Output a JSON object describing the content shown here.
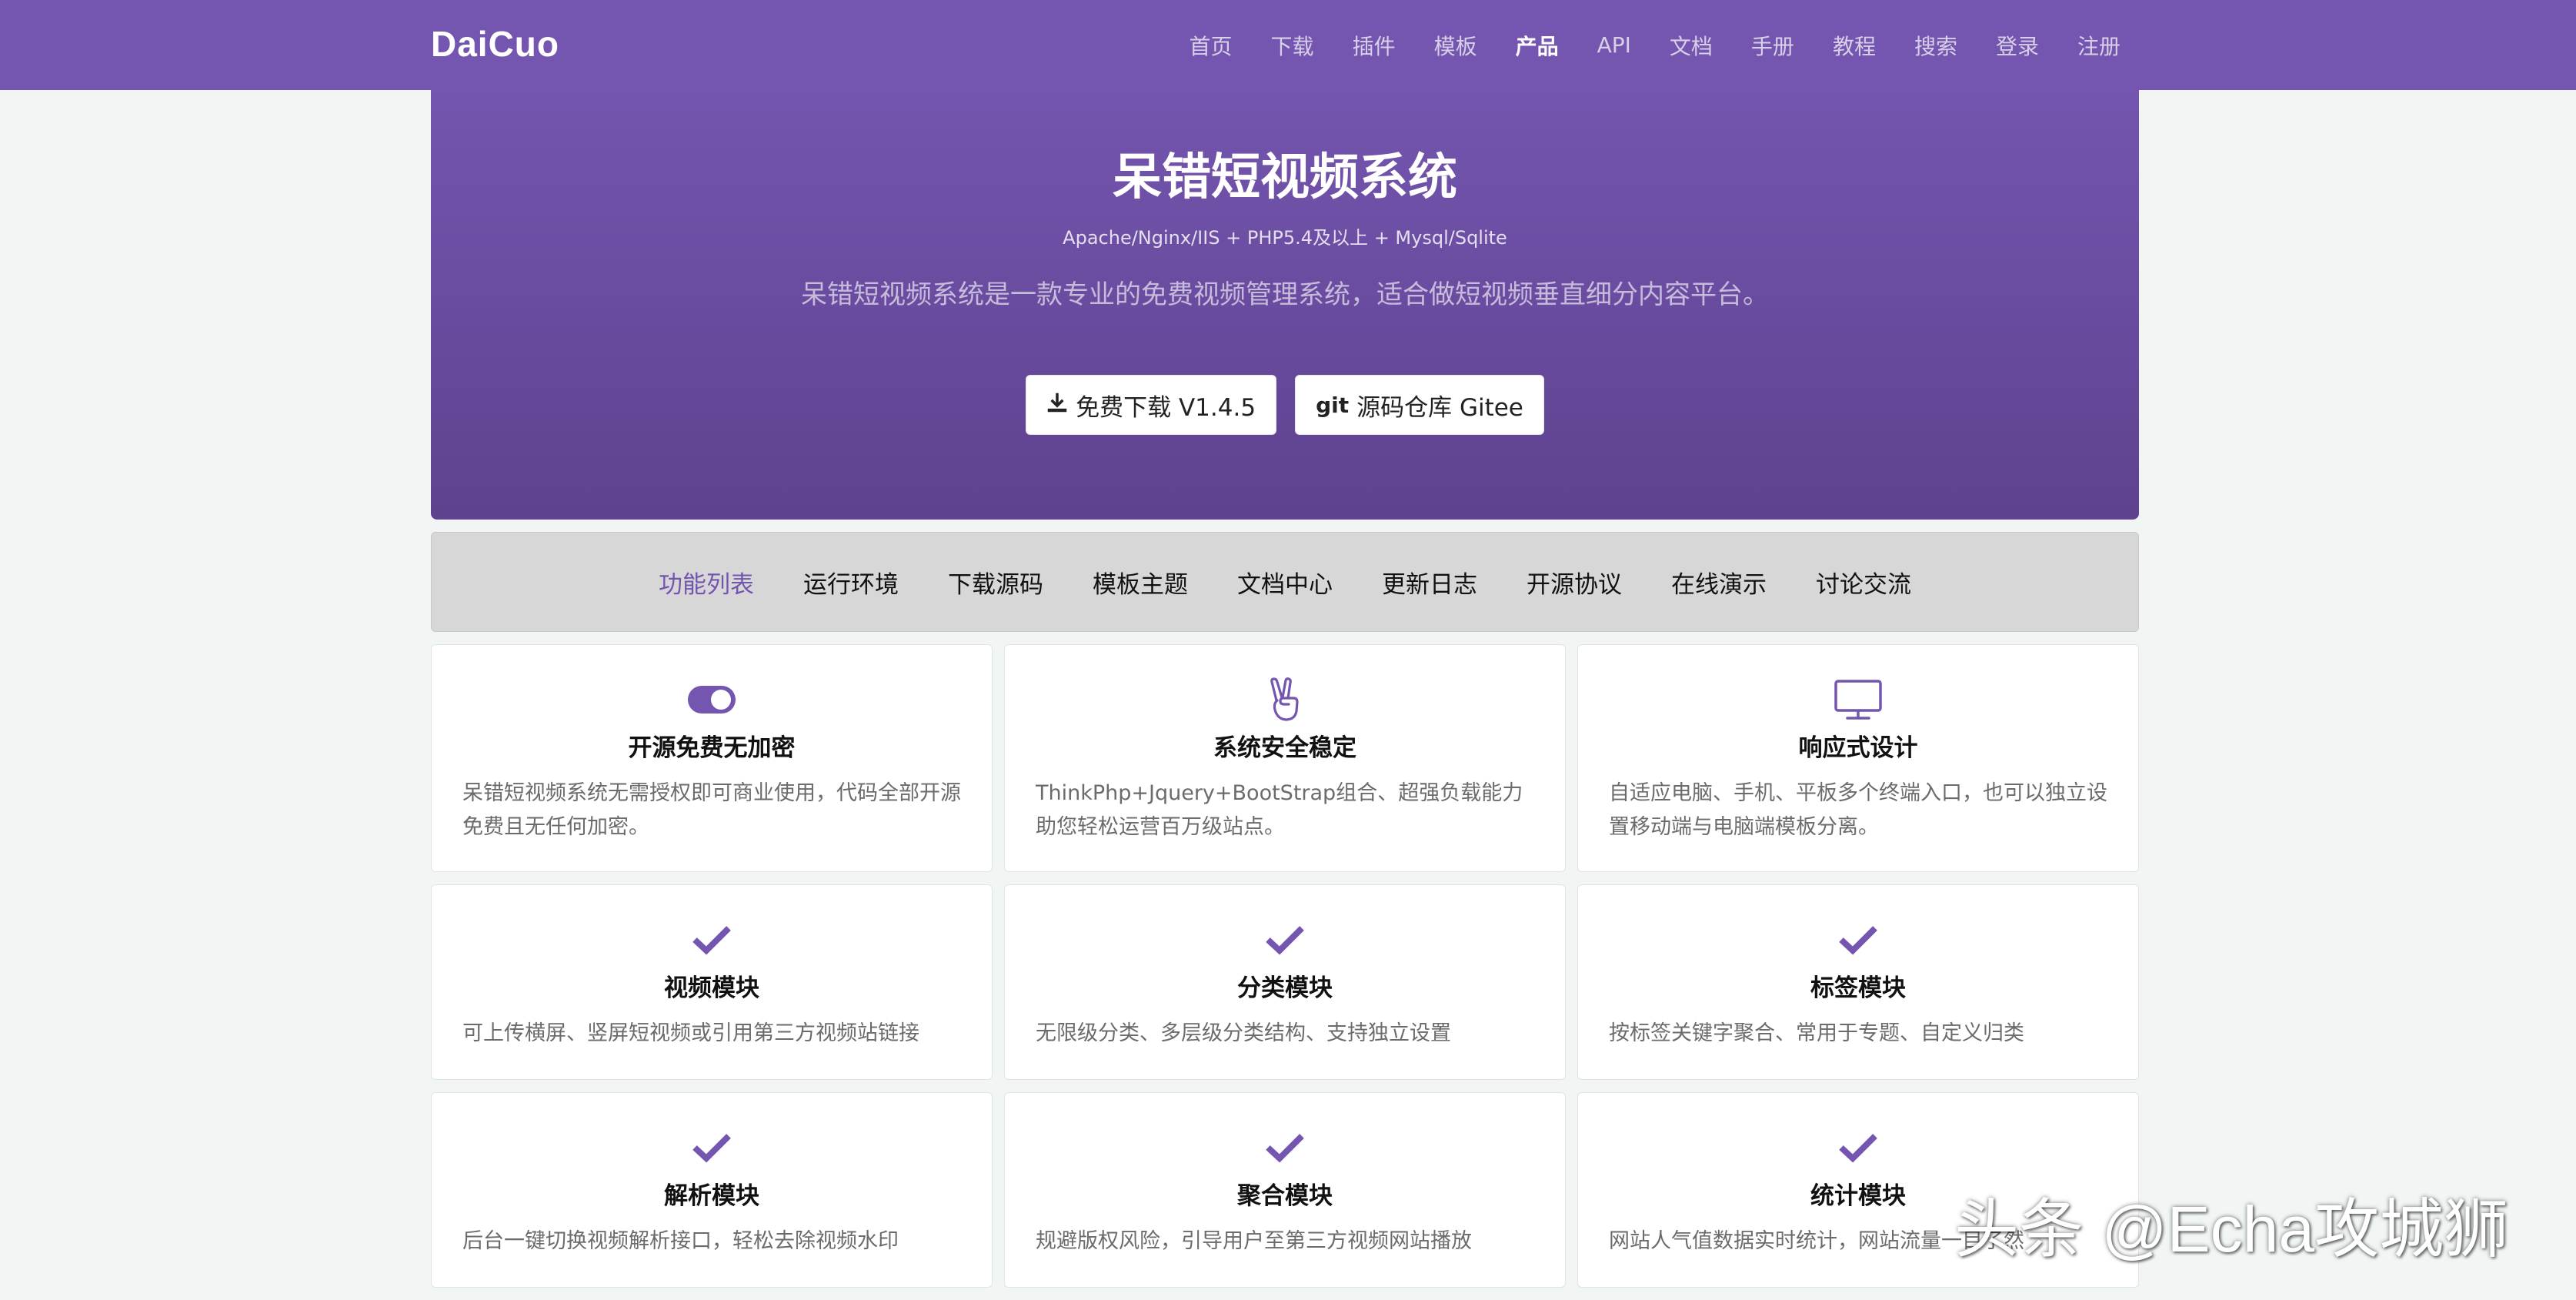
{
  "nav": {
    "brand": "DaiCuo",
    "links": [
      "首页",
      "下载",
      "插件",
      "模板",
      "产品",
      "API",
      "文档",
      "手册",
      "教程",
      "搜索",
      "登录",
      "注册"
    ],
    "active": "产品"
  },
  "hero": {
    "title": "呆错短视频系统",
    "subtitle": "Apache/Nginx/IIS + PHP5.4及以上 + Mysql/Sqlite",
    "desc": "呆错短视频系统是一款专业的免费视频管理系统，适合做短视频垂直细分内容平台。",
    "download_label": "免费下载 V1.4.5",
    "gitee_icon_text": "git",
    "gitee_label": "源码仓库 Gitee"
  },
  "tabs": [
    "功能列表",
    "运行环境",
    "下载源码",
    "模板主题",
    "文档中心",
    "更新日志",
    "开源协议",
    "在线演示",
    "讨论交流"
  ],
  "active_tab": "功能列表",
  "features": [
    {
      "icon": "toggle-icon",
      "title": "开源免费无加密",
      "desc": "呆错短视频系统无需授权即可商业使用，代码全部开源免费且无任何加密。"
    },
    {
      "icon": "victory-hand-icon",
      "title": "系统安全稳定",
      "desc": "ThinkPhp+Jquery+BootStrap组合、超强负载能力助您轻松运营百万级站点。"
    },
    {
      "icon": "monitor-icon",
      "title": "响应式设计",
      "desc": "自适应电脑、手机、平板多个终端入口，也可以独立设置移动端与电脑端模板分离。"
    },
    {
      "icon": "check-icon",
      "title": "视频模块",
      "desc": "可上传横屏、竖屏短视频或引用第三方视频站链接"
    },
    {
      "icon": "check-icon",
      "title": "分类模块",
      "desc": "无限级分类、多层级分类结构、支持独立设置"
    },
    {
      "icon": "check-icon",
      "title": "标签模块",
      "desc": "按标签关键字聚合、常用于专题、自定义归类"
    },
    {
      "icon": "check-icon",
      "title": "解析模块",
      "desc": "后台一键切换视频解析接口，轻松去除视频水印"
    },
    {
      "icon": "check-icon",
      "title": "聚合模块",
      "desc": "规避版权风险，引导用户至第三方视频网站播放"
    },
    {
      "icon": "check-icon",
      "title": "统计模块",
      "desc": "网站人气值数据实时统计，网站流量一目了然"
    }
  ],
  "colors": {
    "accent": "#7455af",
    "hero_bottom": "#5e428f",
    "tabs_bg": "#d7d7d7"
  },
  "watermark": "头条 @Echa攻城狮"
}
